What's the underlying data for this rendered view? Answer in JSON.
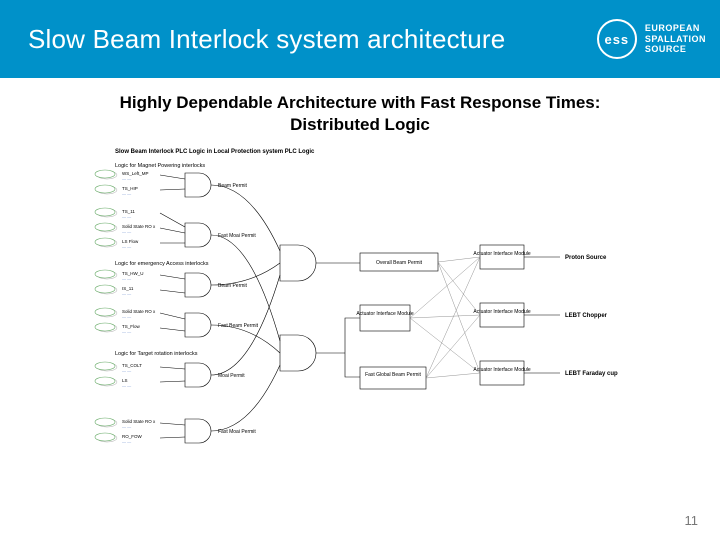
{
  "header": {
    "title": "Slow Beam Interlock system architecture",
    "brand_abbr": "ess",
    "brand_line1": "EUROPEAN",
    "brand_line2": "SPALLATION",
    "brand_line3": "SOURCE"
  },
  "subtitle_line1": "Highly Dependable Architecture with Fast Response Times:",
  "subtitle_line2": "Distributed Logic",
  "diagram": {
    "title": "Slow Beam Interlock PLC Logic in Local Protection system PLC Logic",
    "groups": [
      "Logic for Magnet Powering interlocks",
      "Logic for emergency Access interlocks",
      "Logic for Target rotation interlocks"
    ],
    "io_labels": [
      "WS_Left_MP",
      "TS_HIP",
      "TS_11",
      "Solid State RO x",
      "LS Flow",
      "TS_HW_U",
      "IS_11",
      "Solid State RO x",
      "TS_Flow",
      "TS_COLT",
      "LS",
      "Solid State RO x",
      "RO_FOW"
    ],
    "gate_labels": [
      "Beam Permit",
      "Fast Moai Permit",
      "Beam Permit",
      "Fast Beam Permit",
      "Moai Permit",
      "Fast Moai Permit"
    ],
    "mid_boxes": [
      "Overall Beam Permit",
      "Actuator Interface Module",
      "Fast Global Beam Permit"
    ],
    "actuator": "Actuator Interface Module",
    "outputs": [
      "Proton Source",
      "LEBT Chopper",
      "LEBT Faraday cup"
    ]
  },
  "page_number": "11"
}
